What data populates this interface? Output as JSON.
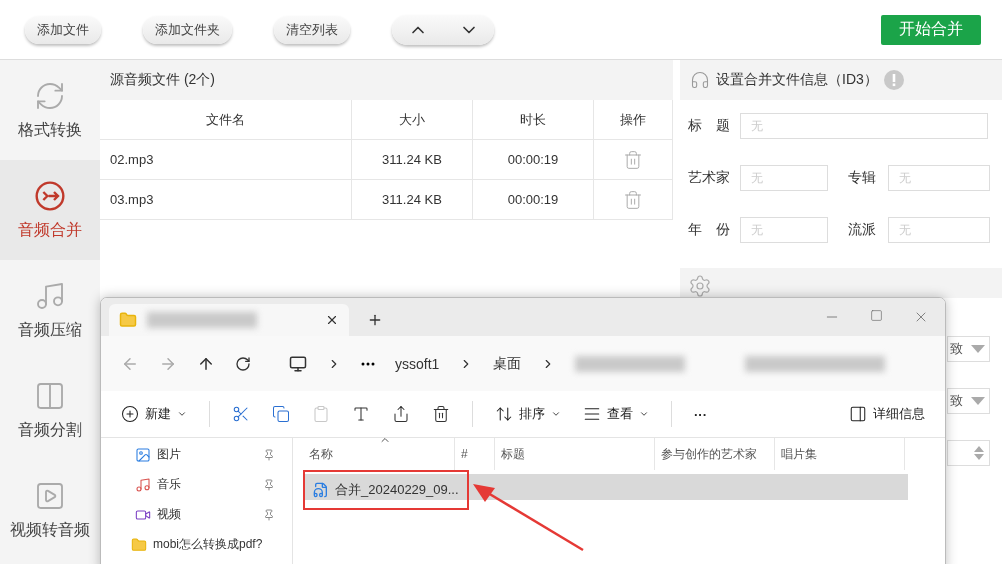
{
  "toolbar": {
    "buttons": [
      "添加文件",
      "添加文件夹",
      "清空列表"
    ],
    "start_button": "开始合并"
  },
  "sidebar": {
    "items": [
      {
        "label": "格式转换",
        "selected": false
      },
      {
        "label": "音频合并",
        "selected": true
      },
      {
        "label": "音频压缩",
        "selected": false
      },
      {
        "label": "音频分割",
        "selected": false
      },
      {
        "label": "视频转音频",
        "selected": false
      }
    ]
  },
  "file_panel": {
    "title": "源音频文件 (2个)",
    "columns": [
      "文件名",
      "大小",
      "时长",
      "操作"
    ],
    "rows": [
      {
        "name": "02.mp3",
        "size": "311.24 KB",
        "duration": "00:00:19"
      },
      {
        "name": "03.mp3",
        "size": "311.24 KB",
        "duration": "00:00:19"
      }
    ]
  },
  "id3": {
    "title": "设置合并文件信息（ID3）",
    "fields": [
      {
        "label": "标　题",
        "placeholder": "无"
      },
      {
        "label": "艺术家",
        "placeholder": "无"
      },
      {
        "label": "专辑",
        "placeholder": "无"
      },
      {
        "label": "年　份",
        "placeholder": "无"
      },
      {
        "label": "流派",
        "placeholder": "无"
      }
    ]
  },
  "settings": {
    "dropdowns": [
      {
        "value": "致"
      },
      {
        "value": "致"
      }
    ]
  },
  "explorer": {
    "breadcrumb": [
      "yssoft1",
      "桌面"
    ],
    "new_label": "新建",
    "icon_buttons": [
      {
        "disabled": false
      },
      {
        "disabled": false
      },
      {
        "disabled": true
      },
      {
        "disabled": false
      },
      {
        "disabled": false
      },
      {
        "disabled": false
      }
    ],
    "sort_label": "排序",
    "view_label": "查看",
    "more_label": "···",
    "details_label": "详细信息",
    "nav": [
      {
        "label": "图片",
        "pinned": true
      },
      {
        "label": "音乐",
        "pinned": true
      },
      {
        "label": "视频",
        "pinned": true
      },
      {
        "label": "mobi怎么转换成pdf?",
        "pinned": false
      }
    ],
    "columns": [
      "名称",
      "#",
      "标题",
      "参与创作的艺术家",
      "唱片集"
    ],
    "files": [
      {
        "name": "合并_20240229_09...",
        "selected": true
      }
    ]
  }
}
